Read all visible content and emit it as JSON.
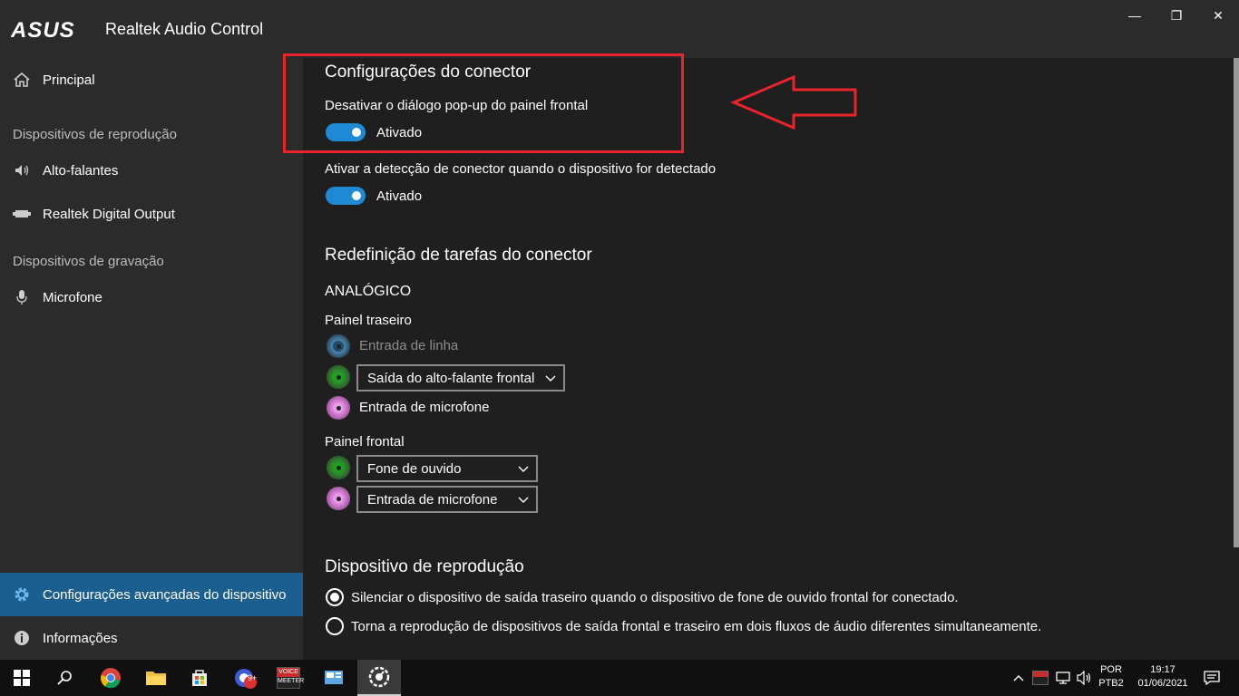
{
  "window": {
    "brand": "ASUS",
    "title": "Realtek Audio Control",
    "min_label": "—",
    "max_label": "❐",
    "close_label": "✕"
  },
  "sidebar": {
    "home": "Principal",
    "playback_section": "Dispositivos de reprodução",
    "speakers": "Alto-falantes",
    "digital_output": "Realtek Digital Output",
    "recording_section": "Dispositivos de gravação",
    "microphone": "Microfone",
    "advanced": "Configurações avançadas do dispositivo",
    "info": "Informações"
  },
  "connector_settings": {
    "heading": "Configurações do conector",
    "popup_label": "Desativar o diálogo pop-up do painel frontal",
    "popup_state": "Ativado",
    "detection_label": "Ativar a detecção de conector quando o dispositivo for detectado",
    "detection_state": "Ativado"
  },
  "retasking": {
    "heading": "Redefinição de tarefas do conector",
    "analog_label": "ANALÓGICO",
    "rear_panel_label": "Painel traseiro",
    "rear_line_in": "Entrada de linha",
    "rear_green_select": "Saída do alto-falante frontal",
    "rear_mic": "Entrada de microfone",
    "front_panel_label": "Painel frontal",
    "front_green_select": "Fone de ouvido",
    "front_pink_select": "Entrada de microfone"
  },
  "playback_device": {
    "heading": "Dispositivo de reprodução",
    "option_mute": "Silenciar o dispositivo de saída traseiro quando o dispositivo de fone de ouvido frontal for conectado.",
    "option_streams": "Torna a reprodução de dispositivos de saída frontal e traseiro em dois fluxos de áudio diferentes simultaneamente.",
    "selected": "option_mute"
  },
  "taskbar": {
    "voicemeeter_label_1": "VOICE",
    "voicemeeter_label_2": "MEETER",
    "badge": "9+",
    "lang_1": "POR",
    "lang_2": "PTB2",
    "time": "19:17",
    "date": "01/06/2021"
  },
  "colors": {
    "accent": "#1e8ad6",
    "active_nav": "#1a5f8f",
    "annotation_red": "#e8232b"
  }
}
